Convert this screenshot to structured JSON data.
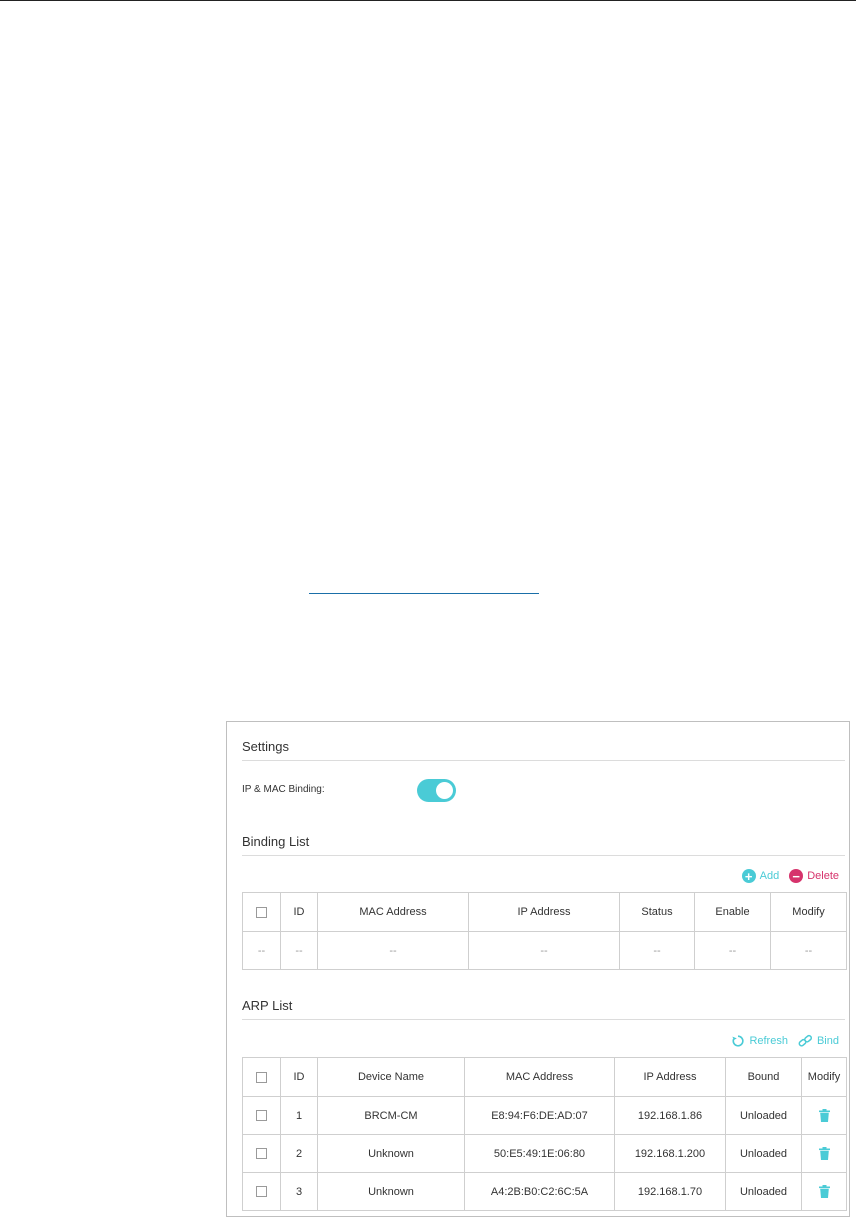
{
  "settings": {
    "title": "Settings",
    "ip_mac_binding_label": "IP & MAC Binding:",
    "ip_mac_binding_enabled": true
  },
  "binding_list": {
    "title": "Binding List",
    "add_label": "Add",
    "delete_label": "Delete",
    "headers": [
      "ID",
      "MAC Address",
      "IP Address",
      "Status",
      "Enable",
      "Modify"
    ],
    "empty_row": [
      "--",
      "--",
      "--",
      "--",
      "--",
      "--",
      "--"
    ]
  },
  "arp_list": {
    "title": "ARP List",
    "refresh_label": "Refresh",
    "bind_label": "Bind",
    "headers": [
      "ID",
      "Device Name",
      "MAC Address",
      "IP Address",
      "Bound",
      "Modify"
    ],
    "rows": [
      {
        "id": "1",
        "device": "BRCM-CM",
        "mac": "E8:94:F6:DE:AD:07",
        "ip": "192.168.1.86",
        "bound": "Unloaded"
      },
      {
        "id": "2",
        "device": "Unknown",
        "mac": "50:E5:49:1E:06:80",
        "ip": "192.168.1.200",
        "bound": "Unloaded"
      },
      {
        "id": "3",
        "device": "Unknown",
        "mac": "A4:2B:B0:C2:6C:5A",
        "ip": "192.168.1.70",
        "bound": "Unloaded"
      }
    ]
  },
  "colors": {
    "accent": "#4acbd6",
    "delete": "#d6336c",
    "link_underline": "#1a6fa8"
  }
}
